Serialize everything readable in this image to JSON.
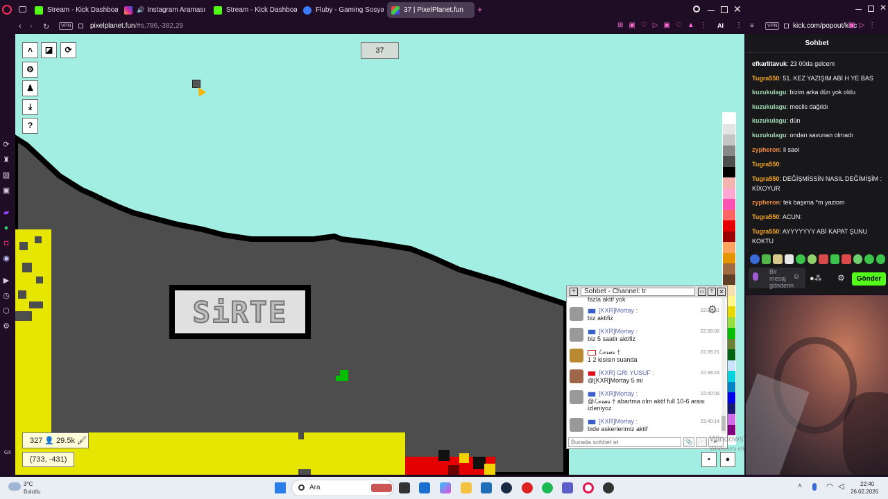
{
  "tabs": [
    {
      "label": "Stream - Kick Dashboard",
      "icon": "kick-icon"
    },
    {
      "label": "Instagram Araması",
      "icon": "instagram-icon"
    },
    {
      "label": "Stream - Kick Dashboard",
      "icon": "kick-icon"
    },
    {
      "label": "Fluby - Gaming Sosyal Me",
      "icon": "fluby-icon"
    },
    {
      "label": "37 | PixelPlanet.fun",
      "icon": "pixelplanet-icon"
    }
  ],
  "address": {
    "vpn": "VPN",
    "url_host": "pixelplanet.fun",
    "url_path": "/#s,786,-382,29",
    "ai": "AI"
  },
  "address2": {
    "vpn": "VPN",
    "url": "kick.com/popout/kixc"
  },
  "canvas": {
    "counter": "37",
    "sign_text": "SiRTE",
    "online": "327",
    "pixels": "29.5k",
    "coords": "(733, -431)",
    "palette": [
      "#ffffff",
      "#e4e4e4",
      "#c4c4c4",
      "#888888",
      "#4e4e4e",
      "#000000",
      "#f4b3ae",
      "#ffa7d1",
      "#ff54b2",
      "#ff6565",
      "#e50000",
      "#9a0000",
      "#fea460",
      "#e59500",
      "#a06a42",
      "#604028",
      "#f5dfb0",
      "#fff889",
      "#e5d900",
      "#94e044",
      "#02be01",
      "#688338",
      "#006513",
      "#cae3ff",
      "#00d3dd",
      "#0083c7",
      "#0000ea",
      "#191973",
      "#cf6ee4",
      "#820080"
    ]
  },
  "chat": {
    "title": "Sohbet - Channel: tr",
    "messages": [
      {
        "name": "",
        "text": "fazla aktif yok",
        "time": ""
      },
      {
        "name": "[KXR]Mortay",
        "text": "biz aktifiz",
        "time": "22:38:51"
      },
      {
        "name": "[KXR]Mortay",
        "text": "biz 5 saatir aktifiz",
        "time": "22:39:08"
      },
      {
        "name": "ℒ𝓸𝓻𝓪𝓼 †",
        "text": "1 2 kisisin suanda",
        "time": "22:39:21"
      },
      {
        "name": "[KXR] GRI YUSUF",
        "text": "@[KXR]Mortay 5 mi",
        "time": "22:39:24"
      },
      {
        "name": "[KXR]Mortay",
        "text": "@ℒ𝓸𝓻𝓪𝓼 † abartma olm aktif full 10-6 arası izleniyoz",
        "time": "22:40:08"
      },
      {
        "name": "[KXR]Mortay",
        "text": "bide askerlerimiz aktif",
        "time": "22:40:14"
      }
    ],
    "input_placeholder": "Burada sohbet et",
    "send": "↵"
  },
  "kick": {
    "title": "Sohbet",
    "messages": [
      {
        "user": "efkarlitavuk",
        "color": "#ffffff",
        "text": ": 23 00da gelcem"
      },
      {
        "user": "Tugra550",
        "color": "#f5a623",
        "text": ": 51. KEZ YAZIŞIM ABİ H YE BAS"
      },
      {
        "user": "kuzukulagu",
        "color": "#9bd8b0",
        "text": ": bizim arka dün yok oldu"
      },
      {
        "user": "kuzukulagu",
        "color": "#9bd8b0",
        "text": ": meclis dağıldı"
      },
      {
        "user": "kuzukulagu",
        "color": "#9bd8b0",
        "text": ": dün"
      },
      {
        "user": "kuzukulagu",
        "color": "#9bd8b0",
        "text": ": ondan savunan olmadı"
      },
      {
        "user": "zypheron",
        "color": "#f58a3a",
        "text": ": il saol"
      },
      {
        "user": "Tugra550",
        "color": "#f5a623",
        "text": ":"
      },
      {
        "user": "Tugra550",
        "color": "#f5a623",
        "text": ": DEĞİŞMİSSİN NASIL DEĞİMİŞİM : KİXOYUR"
      },
      {
        "user": "zypheron",
        "color": "#f58a3a",
        "text": ": tek başıma *m yaziom"
      },
      {
        "user": "Tugra550",
        "color": "#f5a623",
        "text": ": ACUN:"
      },
      {
        "user": "Tugra550",
        "color": "#f5a623",
        "text": ": AYYYYYYY ABİ KAPAT ŞUNU KOKTU"
      }
    ],
    "input_placeholder": "Bir mesaj gönderin",
    "send": "Gönder"
  },
  "overlay": {
    "line1": "Windows'u Etkinleştir",
    "line2": "Windows'u etkinleştirmek için Ayarlar'a gidin."
  },
  "taskbar": {
    "weather_temp": "3°C",
    "weather_desc": "Bulutlu",
    "search": "Ara",
    "time": "22:40",
    "date": "26.02.2026"
  },
  "sidebar": {
    "gx": "GX"
  }
}
